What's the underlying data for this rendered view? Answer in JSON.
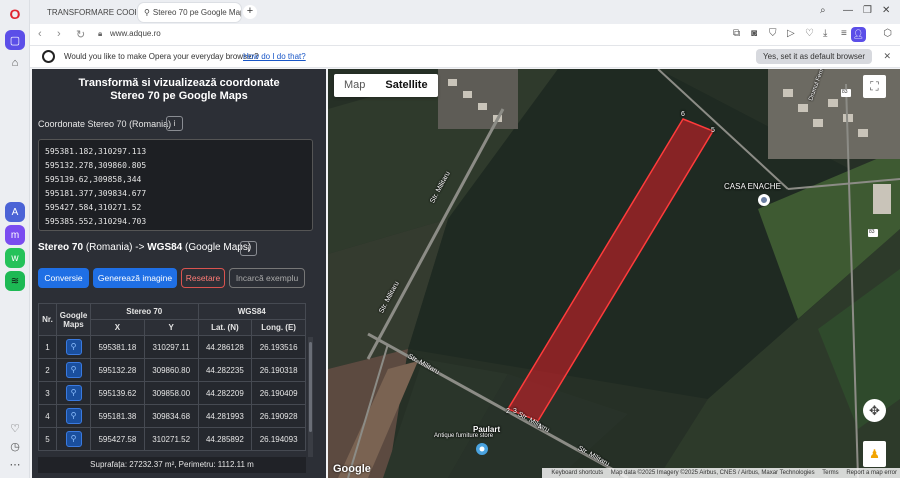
{
  "browser": {
    "tabs": [
      {
        "label": "TRANSFORMARE COORDO",
        "active": false
      },
      {
        "label": "Stereo 70 pe Google Maps",
        "active": true
      }
    ],
    "url": "www.adque.ro",
    "prompt_text": "Would you like to make Opera your everyday browser?",
    "prompt_link": "How do I do that?",
    "prompt_button": "Yes, set it as default browser"
  },
  "panel": {
    "title_line1": "Transformă si vizualizează coordonate",
    "title_line2": "Stereo 70 pe Google Maps",
    "input_label": "Coordonate Stereo 70 (Romania)",
    "coordinates": [
      "595381.182,310297.113",
      "595132.278,309860.805",
      "595139.62,309858,344",
      "595181.377,309834.677",
      "595427.584,310271.52",
      "595385.552,310294.703"
    ],
    "conversion_from": "Stereo 70",
    "conversion_from_suffix": "(Romania) ->",
    "conversion_to": "WGS84",
    "conversion_to_suffix": "(Google Maps)",
    "buttons": {
      "convert": "Conversie",
      "generate": "Generează imagine",
      "reset": "Resetare",
      "load_example": "Incarcă exemplu"
    },
    "table": {
      "headers": {
        "nr": "Nr.",
        "google_maps": "Google Maps",
        "stereo70": "Stereo 70",
        "wgs84": "WGS84",
        "x": "X",
        "y": "Y",
        "lat": "Lat. (N)",
        "long": "Long. (E)"
      },
      "rows": [
        {
          "nr": "1",
          "x": "595381.18",
          "y": "310297.11",
          "lat": "44.286128",
          "long": "26.193516"
        },
        {
          "nr": "2",
          "x": "595132.28",
          "y": "309860.80",
          "lat": "44.282235",
          "long": "26.190318"
        },
        {
          "nr": "3",
          "x": "595139.62",
          "y": "309858.00",
          "lat": "44.282209",
          "long": "26.190409"
        },
        {
          "nr": "4",
          "x": "595181.38",
          "y": "309834.68",
          "lat": "44.281993",
          "long": "26.190928"
        },
        {
          "nr": "5",
          "x": "595427.58",
          "y": "310271.52",
          "lat": "44.285892",
          "long": "26.194093"
        }
      ]
    },
    "summary": "Suprafața: 27232.37 m², Perimetru: 1112.11 m"
  },
  "map": {
    "type_map": "Map",
    "type_satellite": "Satellite",
    "place_label": "CASA ENACHE",
    "poi_name": "Paulart",
    "poi_sub": "Antique furniture store",
    "street": "Str. Militaru",
    "street_top": "Drumul Fermei",
    "road_badge": "83",
    "vertex_labels": [
      "6",
      "5",
      "2",
      "3",
      "4"
    ],
    "google": "Google",
    "attribution": [
      "Keyboard shortcuts",
      "Map data ©2025 Imagery ©2025 Airbus, CNES / Airbus, Maxar Technologies",
      "Terms",
      "Report a map error"
    ]
  }
}
